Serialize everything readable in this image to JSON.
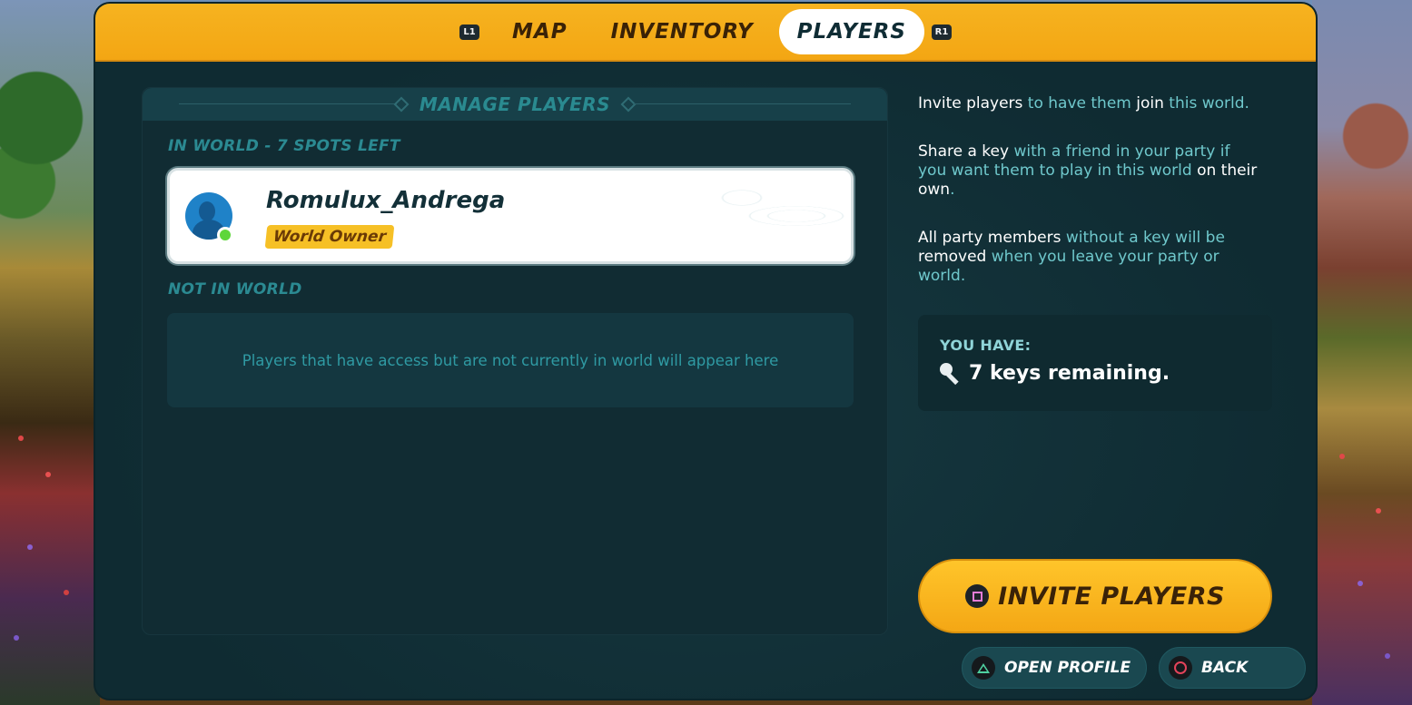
{
  "nav": {
    "left_shoulder": "L1",
    "right_shoulder": "R1",
    "tabs": [
      {
        "label": "MAP"
      },
      {
        "label": "INVENTORY"
      },
      {
        "label": "PLAYERS"
      }
    ],
    "active_tab": "PLAYERS"
  },
  "manage": {
    "title": "MANAGE PLAYERS",
    "in_world_label": "IN WORLD - 7 SPOTS LEFT",
    "players": [
      {
        "name": "Romulux_Andrega",
        "role": "World Owner",
        "status": "online"
      }
    ],
    "not_in_world_label": "NOT IN WORLD",
    "empty_message": "Players that have access but are not currently in world will appear here"
  },
  "info": {
    "p1": {
      "a": "Invite players",
      "b": " to have them ",
      "c": "join",
      "d": " this world."
    },
    "p2": {
      "a": "Share a key",
      "b": " with a friend in your party if you want them to play in this world ",
      "c": "on their own",
      "d": "."
    },
    "p3": {
      "a": "All party members",
      "b": " without a key will be ",
      "c": "removed",
      "d": " when you leave your party or ",
      "e": "world",
      "f": "."
    }
  },
  "keys": {
    "label": "YOU HAVE:",
    "text": "7 keys remaining."
  },
  "actions": {
    "invite": "INVITE PLAYERS",
    "open_profile": "OPEN PROFILE",
    "back": "BACK"
  },
  "colors": {
    "accent_yellow": "#f6b320",
    "panel_bg": "#123038",
    "teal_text": "#2b8a92",
    "online": "#5ed63a"
  }
}
